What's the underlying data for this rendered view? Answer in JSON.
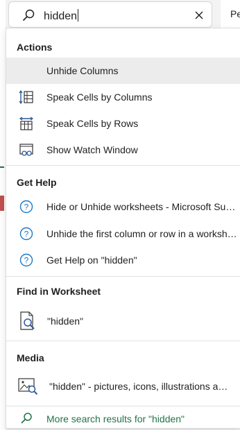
{
  "search": {
    "query": "hidden"
  },
  "background": {
    "right_tab_text": "Pe"
  },
  "sections": {
    "actions": {
      "title": "Actions",
      "items": [
        {
          "label": "Unhide Columns",
          "icon": "unhide-columns-icon"
        },
        {
          "label": "Speak Cells by Columns",
          "icon": "speak-columns-icon"
        },
        {
          "label": "Speak Cells by Rows",
          "icon": "speak-rows-icon"
        },
        {
          "label": "Show Watch Window",
          "icon": "watch-window-icon"
        }
      ]
    },
    "get_help": {
      "title": "Get Help",
      "items": [
        {
          "label": "Hide or Unhide worksheets - Microsoft Support",
          "icon": "help-icon"
        },
        {
          "label": "Unhide the first column or row in a worksheet",
          "icon": "help-icon"
        },
        {
          "label": "Get Help on \"hidden\"",
          "icon": "help-icon"
        }
      ]
    },
    "find": {
      "title": "Find in Worksheet",
      "items": [
        {
          "label": "\"hidden\"",
          "icon": "find-in-sheet-icon"
        }
      ]
    },
    "media": {
      "title": "Media",
      "items": [
        {
          "label": "\"hidden\" - pictures, icons, illustrations and more",
          "icon": "image-search-icon"
        }
      ]
    },
    "more": {
      "label": "More search results for \"hidden\"",
      "icon": "search-icon"
    }
  },
  "colors": {
    "accent": "#217346",
    "help_blue": "#1e78c8",
    "icon_dark": "#2b579a"
  }
}
